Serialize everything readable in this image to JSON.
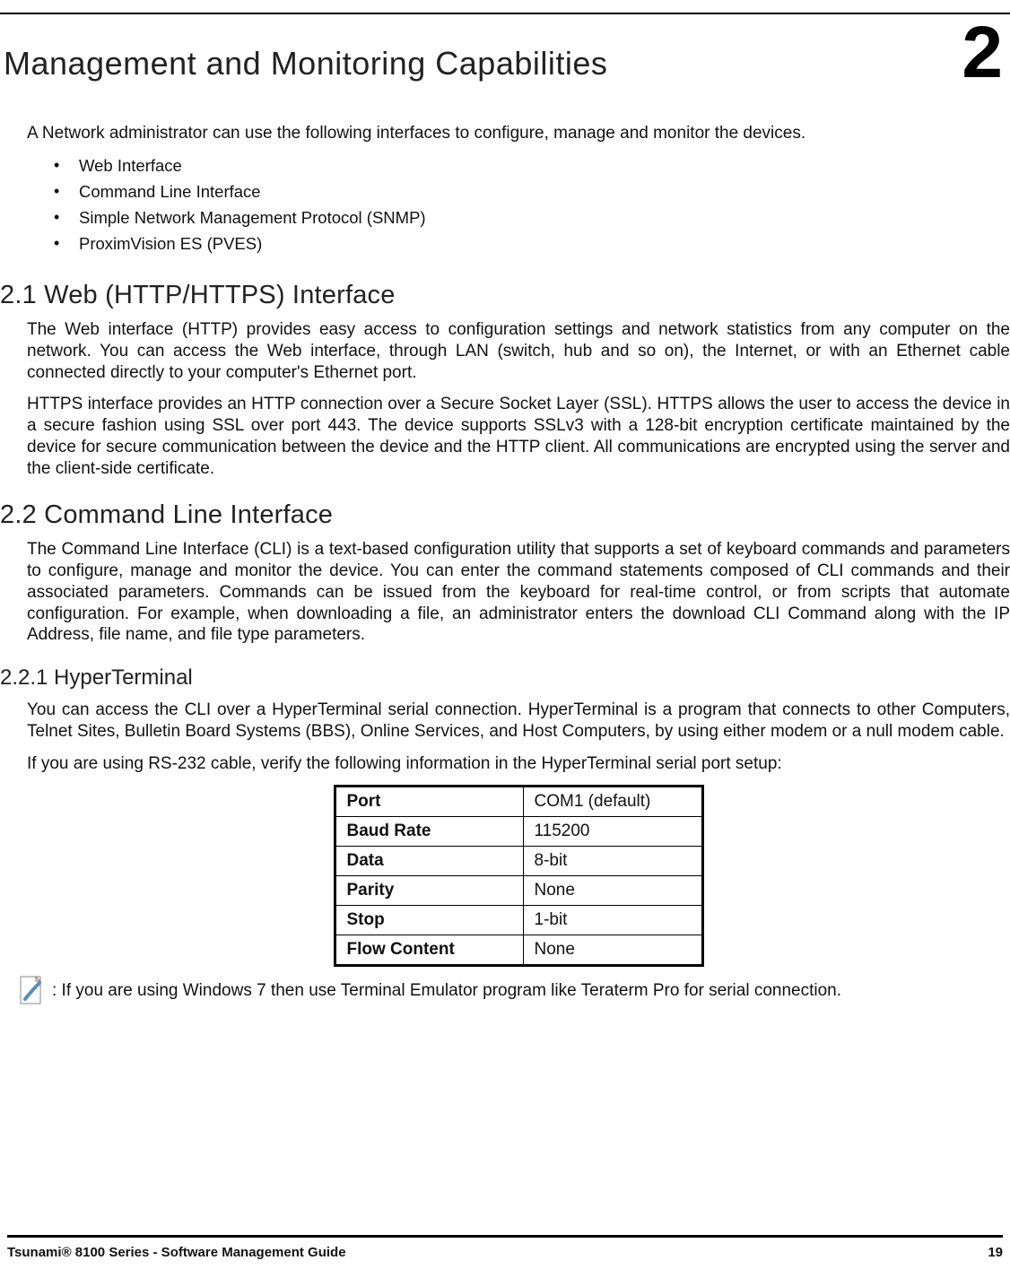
{
  "chapter": {
    "title": "Management and Monitoring Capabilities",
    "number": "2"
  },
  "intro": "A Network administrator can use the following interfaces to configure, manage and monitor the devices.",
  "interfaces": [
    "Web Interface",
    "Command Line Interface",
    "Simple Network Management Protocol (SNMP)",
    "ProximVision ES (PVES)"
  ],
  "section21": {
    "heading": "2.1 Web (HTTP/HTTPS) Interface",
    "p1": "The Web interface (HTTP) provides easy access to configuration settings and network statistics from any computer on the network. You can access the Web interface, through LAN (switch, hub and so on), the Internet, or with an Ethernet cable connected directly to your computer's Ethernet port.",
    "p2": "HTTPS interface provides an HTTP connection over a Secure Socket Layer (SSL). HTTPS allows the user to access the device in a secure fashion using SSL over port 443. The device supports SSLv3 with a 128-bit encryption certificate maintained by the device for secure communication between the device and the HTTP client. All communications are encrypted using the server and the client-side certificate."
  },
  "section22": {
    "heading": "2.2 Command Line Interface",
    "p1": "The Command Line Interface (CLI) is a text-based configuration utility that supports a set of keyboard commands and parameters to configure, manage and monitor the device. You can enter the command statements composed of CLI commands and their associated parameters. Commands can be issued from the keyboard for real-time control, or from scripts that automate configuration. For example, when downloading a file, an administrator enters the download CLI Command along with the IP Address, file name, and file type parameters."
  },
  "section221": {
    "heading": "2.2.1 HyperTerminal",
    "p1": "You can access the CLI over a HyperTerminal serial connection. HyperTerminal is a program that connects to other Computers, Telnet Sites, Bulletin Board Systems (BBS), Online Services, and Host Computers, by using either modem or a null modem cable.",
    "p2": "If you are using RS-232 cable, verify the following information in the HyperTerminal serial port setup:",
    "table": [
      {
        "k": "Port",
        "v": "COM1 (default)"
      },
      {
        "k": "Baud Rate",
        "v": "115200"
      },
      {
        "k": "Data",
        "v": "8-bit"
      },
      {
        "k": "Parity",
        "v": "None"
      },
      {
        "k": "Stop",
        "v": "1-bit"
      },
      {
        "k": "Flow Content",
        "v": "None"
      }
    ],
    "note": ": If you are using Windows 7 then use Terminal Emulator program like Teraterm Pro for serial connection."
  },
  "footer": {
    "left": "Tsunami® 8100 Series - Software Management Guide",
    "right": "19"
  }
}
